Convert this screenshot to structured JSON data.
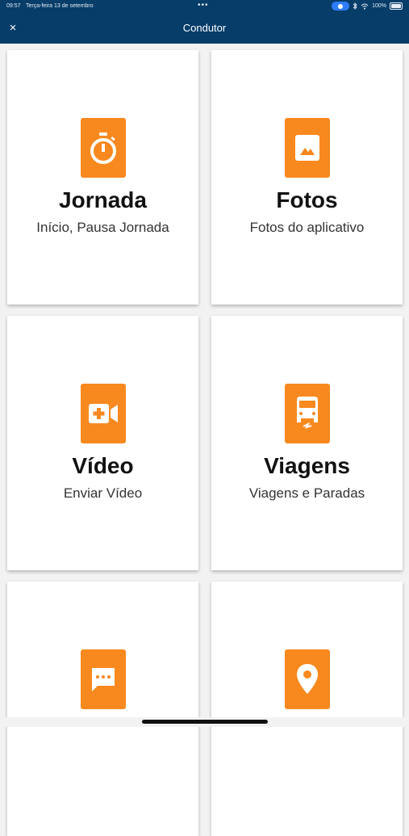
{
  "status_bar": {
    "time": "09:57",
    "date": "Terça-feira 13 de setembro",
    "dots": "•••",
    "battery_text": "100%"
  },
  "header": {
    "title": "Condutor",
    "close_label": "×"
  },
  "cards": [
    {
      "title": "Jornada",
      "subtitle": "Início, Pausa Jornada",
      "icon": "stopwatch-icon"
    },
    {
      "title": "Fotos",
      "subtitle": "Fotos do aplicativo",
      "icon": "photo-icon"
    },
    {
      "title": "Vídeo",
      "subtitle": "Enviar Vídeo",
      "icon": "video-icon"
    },
    {
      "title": "Viagens",
      "subtitle": "Viagens e Paradas",
      "icon": "bus-icon"
    },
    {
      "title": "",
      "subtitle": "",
      "icon": "message-icon"
    },
    {
      "title": "",
      "subtitle": "",
      "icon": "location-pin-icon"
    }
  ],
  "colors": {
    "header": "#063d69",
    "accent": "#f7891f",
    "background": "#f2f2f2"
  }
}
